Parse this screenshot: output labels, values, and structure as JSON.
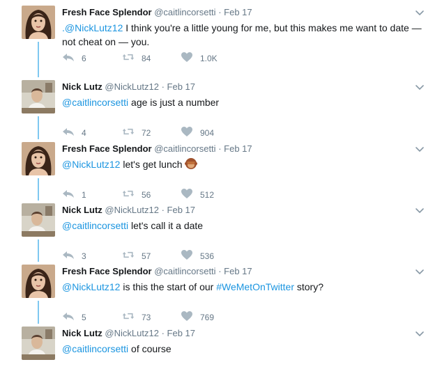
{
  "tweets": [
    {
      "author": "Fresh Face Splendor",
      "handle": "@caitlincorsetti",
      "date": "Feb 17",
      "avatar": "woman-avatar",
      "mention": ".@NickLutz12",
      "text": " I think you're a little young for me, but this makes me want to date — not cheat on — you.",
      "replies": "6",
      "retweets": "84",
      "likes": "1.0K"
    },
    {
      "author": "Nick Lutz",
      "handle": "@NickLutz12",
      "date": "Feb 17",
      "avatar": "man-avatar",
      "mention": "@caitlincorsetti",
      "text": " age is just a number",
      "replies": "4",
      "retweets": "72",
      "likes": "904"
    },
    {
      "author": "Fresh Face Splendor",
      "handle": "@caitlincorsetti",
      "date": "Feb 17",
      "avatar": "woman-avatar",
      "mention": "@NickLutz12",
      "text": " let's get lunch ",
      "emoji": "see-no-evil-monkey",
      "replies": "1",
      "retweets": "56",
      "likes": "512"
    },
    {
      "author": "Nick Lutz",
      "handle": "@NickLutz12",
      "date": "Feb 17",
      "avatar": "man-avatar",
      "mention": "@caitlincorsetti",
      "text": " let's call it a date",
      "replies": "3",
      "retweets": "57",
      "likes": "536"
    },
    {
      "author": "Fresh Face Splendor",
      "handle": "@caitlincorsetti",
      "date": "Feb 17",
      "avatar": "woman-avatar",
      "mention": "@NickLutz12",
      "text": " is this the start of our ",
      "hashtag": "#WeMetOnTwitter",
      "text_after": " story?",
      "replies": "5",
      "retweets": "73",
      "likes": "769"
    },
    {
      "author": "Nick Lutz",
      "handle": "@NickLutz12",
      "date": "Feb 17",
      "avatar": "man-avatar",
      "mention": "@caitlincorsetti",
      "text": " of course"
    }
  ],
  "separator": "·",
  "colors": {
    "link": "#1b95e0",
    "muted": "#657786",
    "thread": "#7fc8f0"
  }
}
